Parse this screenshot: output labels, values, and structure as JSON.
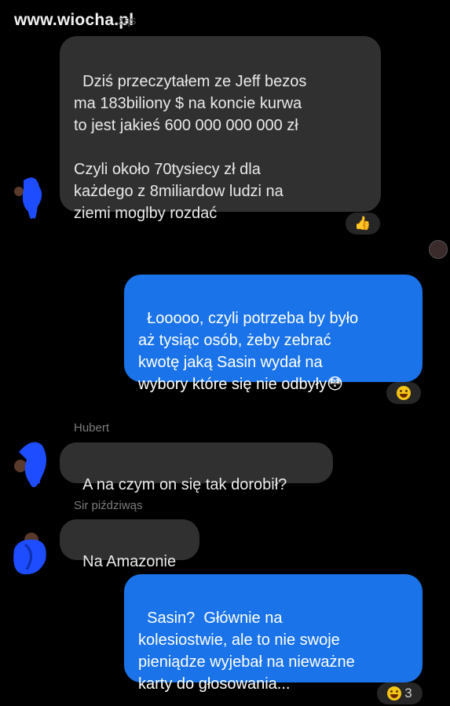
{
  "watermark": "www.wiocha.pl",
  "top_sender_partial": "ząs",
  "messages": [
    {
      "direction": "incoming",
      "text": "Dziś przeczytałem ze Jeff bezos\nma 183biliony $ na koncie kurwa\nto jest jakieś 600 000 000 000 zł\n\nCzyli około 70tysiecy zł dla\nkażdego z 8miliardow ludzi na\nziemi moglby rozdać",
      "reaction": "👍"
    },
    {
      "direction": "outgoing",
      "text": "Łooooo, czyli potrzeba by było\naż tysiąc osób, żeby zebrać\nkwotę jaką Sasin wydał na\nwybory które się nie odbyły",
      "trailing_emoji": "😳",
      "reaction": "😆"
    },
    {
      "direction": "incoming",
      "sender": "Hubert",
      "text": "A na czym on się tak dorobił?"
    },
    {
      "direction": "incoming",
      "sender": "Sir piździwąs",
      "text": "Na Amazonie"
    },
    {
      "direction": "outgoing",
      "text": "Sasin?  Głównie na\nkolesiostwie, ale to nie swoje\npieniądze wyjebał na nieważne\nkarty do głosowania...",
      "reaction": "😆",
      "reaction_count": "3"
    }
  ],
  "colors": {
    "background": "#000000",
    "incoming_bubble": "#303030",
    "outgoing_bubble": "#1a73e8",
    "scribble": "#1e4dff"
  }
}
